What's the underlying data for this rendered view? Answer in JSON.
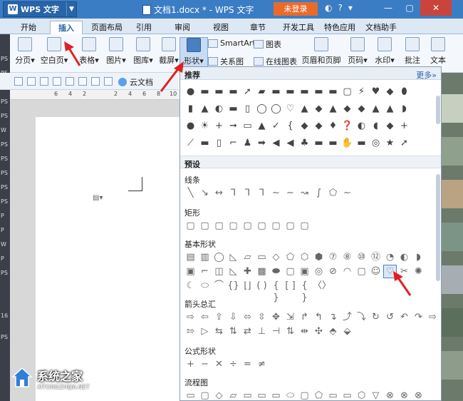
{
  "titlebar": {
    "app_name": "WPS 文字",
    "doc_title": "文档1.docx * - WPS 文字",
    "login_label": "未登录",
    "minimize": "—",
    "maximize": "▢",
    "close": "✕"
  },
  "tabs": [
    "开始",
    "插入",
    "页面布局",
    "引用",
    "审阅",
    "视图",
    "章节",
    "开发工具",
    "特色应用",
    "文档助手"
  ],
  "active_tab": "插入",
  "ribbon": {
    "items": [
      {
        "label": "分页",
        "icon": "page-break-icon"
      },
      {
        "label": "空白页",
        "icon": "blank-page-icon"
      },
      {
        "label": "表格",
        "icon": "table-icon"
      },
      {
        "label": "图片",
        "icon": "picture-icon"
      },
      {
        "label": "图库",
        "icon": "gallery-icon"
      },
      {
        "label": "截屏",
        "icon": "screenshot-icon"
      },
      {
        "label": "形状",
        "icon": "shapes-icon"
      },
      {
        "label": "页眉和页脚",
        "icon": "header-footer-icon"
      },
      {
        "label": "页码",
        "icon": "page-number-icon"
      },
      {
        "label": "水印",
        "icon": "watermark-icon"
      },
      {
        "label": "批注",
        "icon": "comment-icon"
      },
      {
        "label": "文本",
        "icon": "textbox-icon"
      }
    ],
    "small": {
      "smartart": "SmartArt",
      "chart": "图表",
      "relation": "关系图",
      "online_chart": "在线图表"
    }
  },
  "quick_toolbar": {
    "cloud_label": "云文档"
  },
  "ruler_marks": [
    "6",
    "4",
    "2",
    "2",
    "4",
    "6",
    "8",
    "10"
  ],
  "left_strip_labels": [
    "PS",
    "PS",
    "PS",
    "PS",
    "PS",
    "W",
    "PS",
    "PS",
    "PS",
    "PS",
    "PS",
    "P",
    "P",
    "W",
    "P",
    "PS",
    "16",
    "PS"
  ],
  "panel": {
    "recommended_title": "推荐",
    "more_label": "更多»",
    "preset_title": "预设",
    "categories": {
      "lines": "线条",
      "rect": "矩形",
      "basic": "基本形状",
      "arrows": "箭头总汇",
      "formula": "公式形状",
      "flowchart": "流程图"
    },
    "rows": {
      "rec1": [
        "●",
        "▬",
        "▬",
        "▬",
        "➚",
        "▰",
        "▬",
        "▬",
        "▬",
        "▬",
        "▬",
        "▢",
        "⚡",
        "♥",
        "◆",
        "⬮"
      ],
      "rec2": [
        "▮",
        "▲",
        "◐",
        "▬",
        "▯",
        "◯",
        "◯",
        "♡",
        "▲",
        "◆",
        "▲",
        "◆",
        "◆",
        "▲",
        "▲",
        "◗"
      ],
      "rec3": [
        "●",
        "☀",
        "+",
        "➞",
        "▭",
        "▲",
        "✓",
        "{",
        "◆",
        "◆",
        "♦",
        "❓",
        "◐",
        "◖",
        "◆",
        "+"
      ],
      "rec4": [
        "⟋",
        "▬",
        "▯",
        "⌐",
        "♟",
        "➡",
        "◀",
        "◀",
        "♣",
        "▬",
        "▬",
        "✋",
        "▬",
        "◎",
        "★",
        "➚"
      ],
      "lines": [
        "╲",
        "↘",
        "↔",
        "⅂",
        "⅂",
        "⅂",
        "∼",
        "∼",
        "↝",
        "∫",
        "⬠",
        "∼"
      ],
      "rect": [
        "▢",
        "▢",
        "▢",
        "▢",
        "▢",
        "▢",
        "▢",
        "▢",
        "▢"
      ],
      "basic1": [
        "▤",
        "▥",
        "◯",
        "◺",
        "▱",
        "▭",
        "◇",
        "⬠",
        "⬡",
        "⬢",
        "⑦",
        "⑧",
        "⑩",
        "⑫",
        "◔",
        "◐",
        "◗"
      ],
      "basic2": [
        "▣",
        "⌐",
        "◫",
        "◺",
        "✚",
        "▩",
        "⬬",
        "▢",
        "▣",
        "◎",
        "⊘",
        "◠",
        "▢",
        "☺",
        "♡",
        "✂",
        "✺"
      ],
      "basic3": [
        "☾",
        "⬭",
        "⌒",
        "{}",
        "⌊⌋",
        "( )",
        "{ }",
        "[ ]",
        "{ }",
        "〈〉"
      ],
      "arrows1": [
        "⇨",
        "⇦",
        "⇧",
        "⇩",
        "⬄",
        "⇳",
        "✥",
        "⇲",
        "↱",
        "↰",
        "↴",
        "⤴",
        "⤵",
        "↻",
        "↺",
        "↶",
        "↷",
        "⇨"
      ],
      "arrows2": [
        "⇰",
        "▷",
        "⇆",
        "⇅",
        "⇄",
        "⊥",
        "⊣",
        "⇅",
        "⇹",
        "✣",
        "⬘",
        "⬙"
      ],
      "formula": [
        "+",
        "−",
        "✕",
        "÷",
        "=",
        "≠"
      ],
      "flow": [
        "▭",
        "▢",
        "◇",
        "▱",
        "▭",
        "▭",
        "▭",
        "⬭",
        "▢",
        "⬠",
        "▭",
        "▭",
        "⬡",
        "▽",
        "⊗",
        "⊗",
        "⊗"
      ]
    }
  },
  "watermark": {
    "name": "系统之家",
    "url": "XITONGZHIJIA.NET"
  }
}
